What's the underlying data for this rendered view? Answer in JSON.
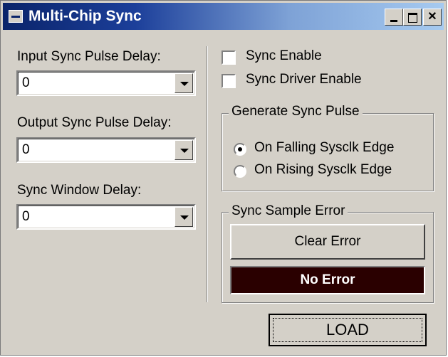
{
  "window": {
    "title": "Multi-Chip Sync"
  },
  "left": {
    "input_sync_pulse_delay": {
      "label": "Input Sync Pulse Delay:",
      "value": "0"
    },
    "output_sync_pulse_delay": {
      "label": "Output Sync Pulse Delay:",
      "value": "0"
    },
    "sync_window_delay": {
      "label": "Sync Window Delay:",
      "value": "0"
    }
  },
  "right": {
    "sync_enable": {
      "label": "Sync Enable",
      "checked": false
    },
    "sync_driver_enable": {
      "label": "Sync Driver Enable",
      "checked": false
    },
    "generate_sync_pulse": {
      "legend": "Generate Sync Pulse",
      "options": [
        {
          "label": "On Falling Sysclk Edge",
          "selected": true
        },
        {
          "label": "On Rising Sysclk Edge",
          "selected": false
        }
      ]
    },
    "sync_sample_error": {
      "legend": "Sync Sample Error",
      "clear_button": "Clear Error",
      "status": "No Error"
    }
  },
  "load_button": "LOAD",
  "icons": [
    "window-icon",
    "minimize-icon",
    "maximize-icon",
    "close-icon",
    "dropdown-arrow-icon"
  ],
  "colors": {
    "titlebar_start": "#0a246a",
    "titlebar_end": "#a6caf0",
    "face": "#d4d0c8",
    "status_bg": "#2a0000",
    "status_text": "#ffffff"
  }
}
